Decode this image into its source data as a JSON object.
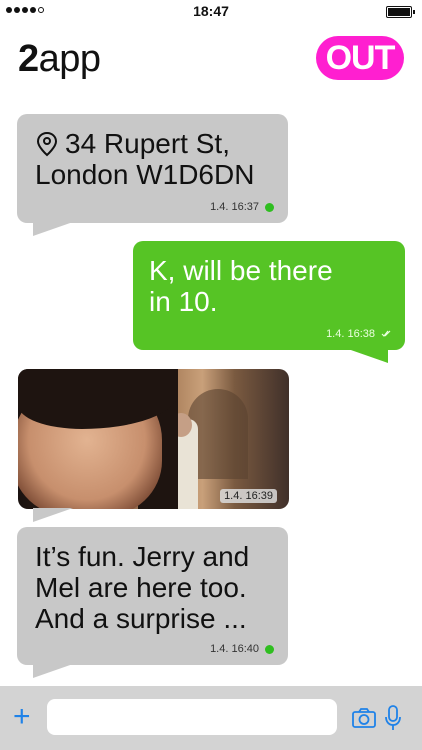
{
  "status_bar": {
    "time": "18:47"
  },
  "header": {
    "app_name_num": "2",
    "app_name_text": "app",
    "out_label": "OUT"
  },
  "messages": [
    {
      "type": "incoming-location",
      "icon": "location-pin-icon",
      "line1": "34 Rupert St,",
      "line2": "London W1D6DN",
      "timestamp": "1.4. 16:37"
    },
    {
      "type": "outgoing",
      "line1": "K, will be there",
      "line2": "in 10.",
      "timestamp": "1.4. 16:38",
      "status_icon": "read-check-icon"
    },
    {
      "type": "incoming-photo",
      "timestamp": "1.4. 16:39"
    },
    {
      "type": "incoming",
      "line1": "It’s fun. Jerry and",
      "line2": "Mel are here too.",
      "line3": "And a surprise ...",
      "timestamp": "1.4. 16:40"
    }
  ],
  "composer": {
    "plus_icon": "plus-icon",
    "camera_icon": "camera-icon",
    "mic_icon": "microphone-icon",
    "placeholder": ""
  },
  "colors": {
    "accent": "#ff1fd0",
    "outgoing": "#56c425",
    "incoming": "#c8c8c8",
    "link": "#1f82e8"
  }
}
